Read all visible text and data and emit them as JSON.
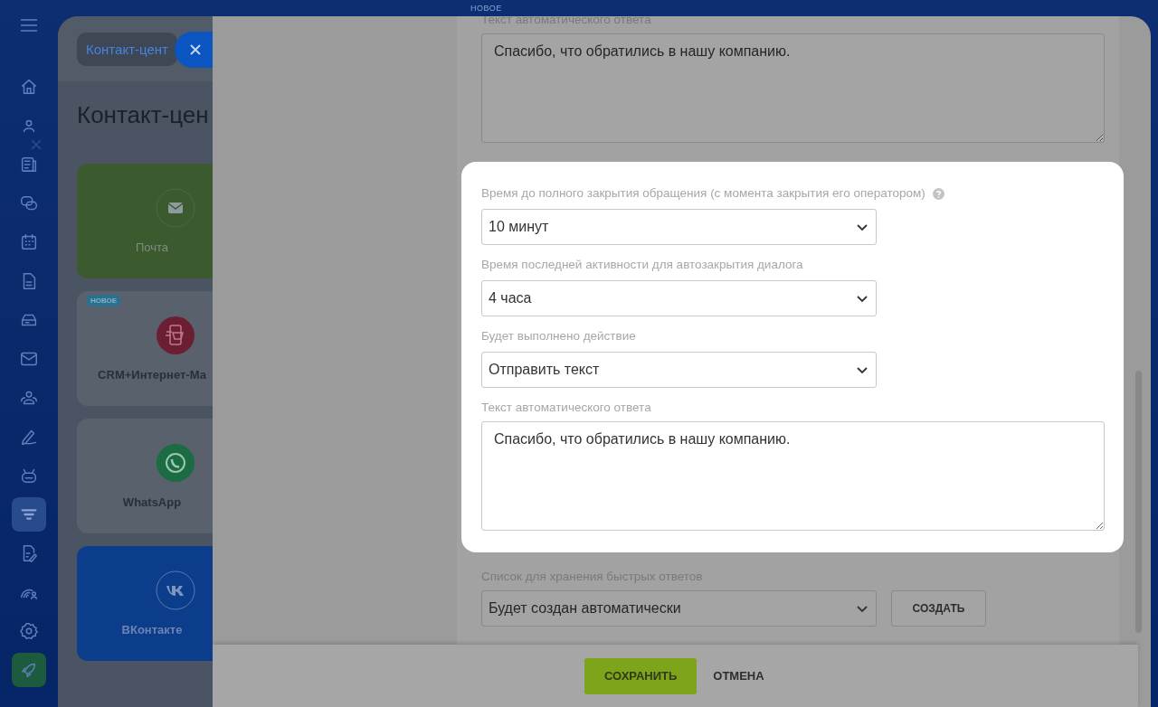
{
  "sidebar": {
    "items": [
      {
        "selected": false
      },
      {
        "selected": false
      },
      {
        "selected": false
      },
      {
        "selected": false
      },
      {
        "selected": false
      },
      {
        "selected": false
      },
      {
        "selected": false
      },
      {
        "selected": false
      },
      {
        "selected": false
      },
      {
        "selected": false
      },
      {
        "selected": false
      },
      {
        "selected": true
      },
      {
        "selected": false
      },
      {
        "selected": false
      },
      {
        "selected": false
      },
      {
        "selected": false
      }
    ]
  },
  "top_badge": "НОВОЕ",
  "back_page": {
    "breadcrumb": "Контакт-цент",
    "title": "Контакт-цен",
    "cards": [
      {
        "label": "Почта",
        "color": "#3b5a2d"
      },
      {
        "label": "CRM+Интернет-Ма",
        "color": "#59616c",
        "badge": "НОВОЕ"
      },
      {
        "label": "WhatsApp",
        "color": "#59616c"
      },
      {
        "label": "ВКонтакте",
        "color": "#0c3d8a"
      }
    ]
  },
  "form": {
    "top_field": {
      "label": "Текст автоматического ответа",
      "value": "Спасибо, что обратились в нашу компанию."
    },
    "highlighted_fields": [
      {
        "kind": "select",
        "label": "Время до полного закрытия обращения (с момента закрытия его оператором)",
        "help": true,
        "value": "10 минут"
      },
      {
        "kind": "select",
        "label": "Время последней активности для автозакрытия диалога",
        "help": false,
        "value": "4 часа"
      },
      {
        "kind": "select",
        "label": "Будет выполнено действие",
        "help": false,
        "value": "Отправить текст"
      },
      {
        "kind": "textarea",
        "label": "Текст автоматического ответа",
        "help": false,
        "value": "Спасибо, что обратились в нашу компанию."
      }
    ],
    "quick_replies": {
      "label": "Список для хранения быстрых ответов",
      "value": "Будет создан автоматически",
      "button": "СОЗДАТЬ"
    }
  },
  "footer": {
    "save": "СОХРАНИТЬ",
    "cancel": "ОТМЕНА"
  }
}
